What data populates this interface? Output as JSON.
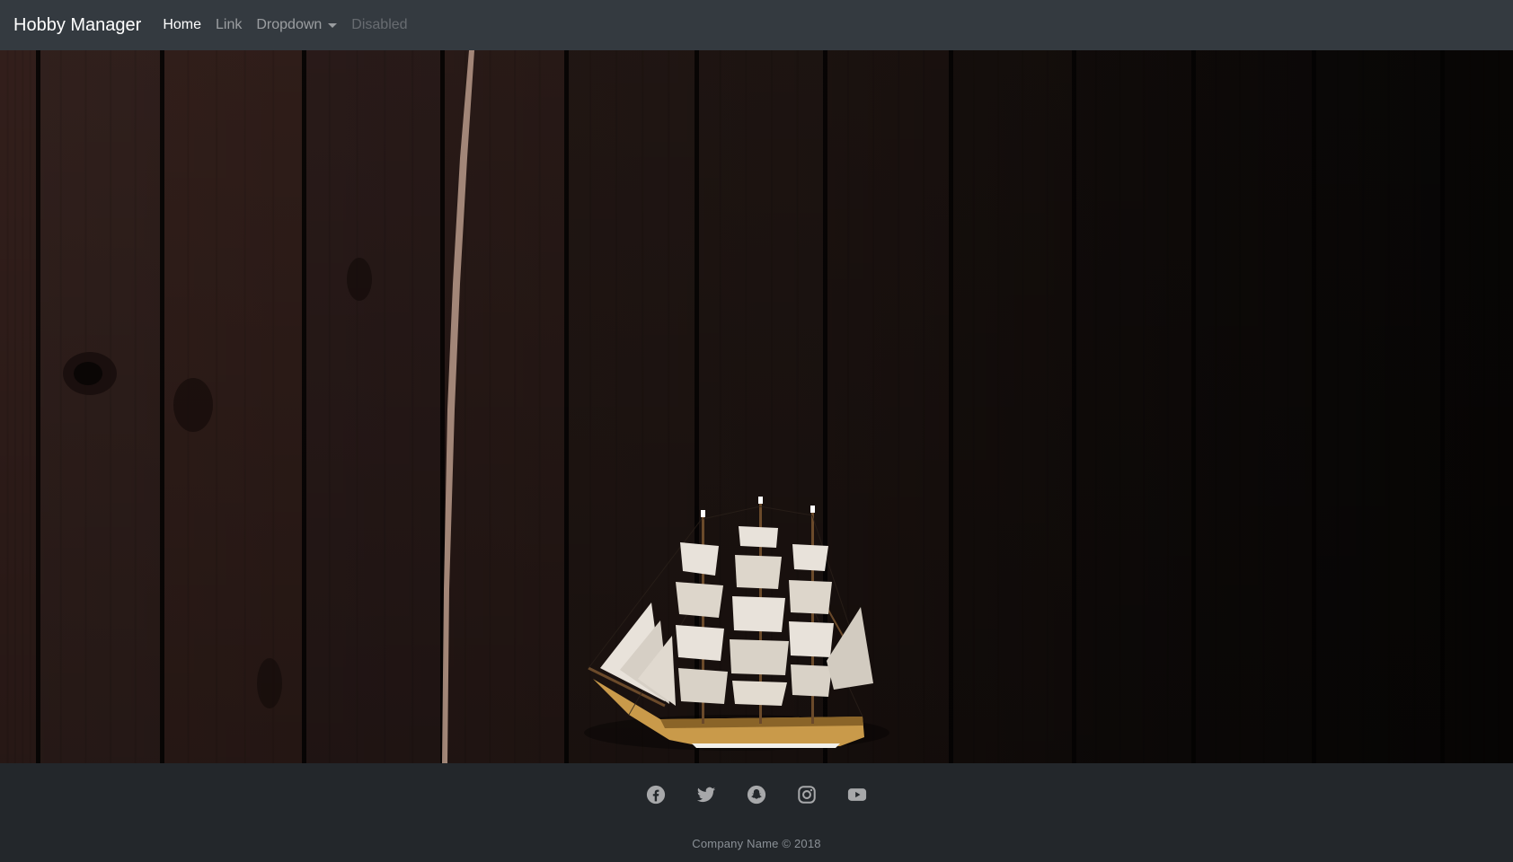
{
  "navbar": {
    "brand": "Hobby Manager",
    "links": [
      {
        "label": "Home",
        "state": "active"
      },
      {
        "label": "Link",
        "state": "normal"
      },
      {
        "label": "Dropdown",
        "state": "normal",
        "has_caret": true
      },
      {
        "label": "Disabled",
        "state": "disabled"
      }
    ]
  },
  "hero": {
    "image": "ship-model-on-dark-wood-wall"
  },
  "footer": {
    "social_icons": [
      "facebook-icon",
      "twitter-icon",
      "snapchat-icon",
      "instagram-icon",
      "youtube-icon"
    ],
    "copyright": "Company Name © 2018"
  },
  "colors": {
    "navbar_bg": "#343a40",
    "footer_bg": "#23272b",
    "wood_dark": "#1a1310",
    "wood_mid": "#3a2520",
    "sail": "#e8e2da",
    "hull": "#c99a4a"
  }
}
